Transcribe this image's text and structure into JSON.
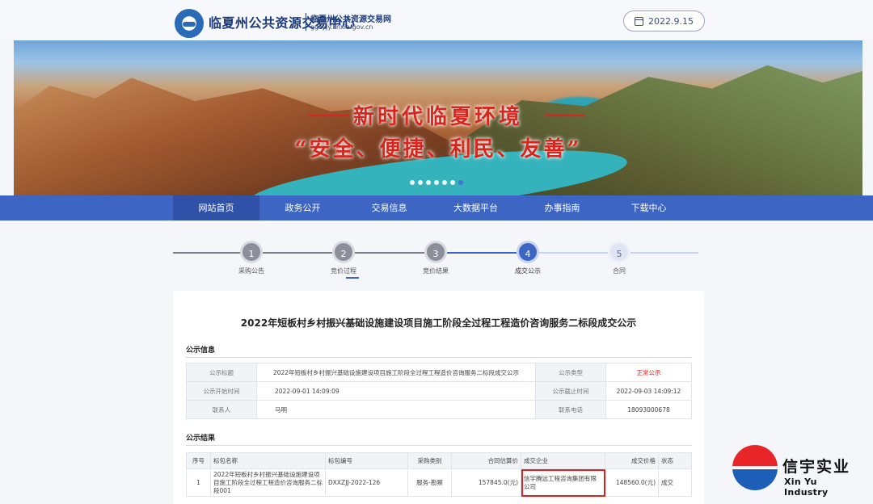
{
  "header": {
    "site_name": "临夏州公共资源交易中心",
    "site_subname": "临夏州公共资源交易网",
    "site_url": "ggzyjy.linxia.gov.cn",
    "date": "2022.9.15"
  },
  "banner": {
    "slogan_main": "新时代临夏环境",
    "slogan_sub": "“安全、便捷、利民、友善”",
    "slide_count": 7,
    "active_slide": 6
  },
  "nav": {
    "items": [
      "网站首页",
      "政务公开",
      "交易信息",
      "大数据平台",
      "办事指南",
      "下载中心"
    ],
    "active_index": 0
  },
  "steps": [
    {
      "num": "1",
      "label": "采购公告",
      "state": "done"
    },
    {
      "num": "2",
      "label": "竞价过程",
      "state": "done"
    },
    {
      "num": "3",
      "label": "竞价结果",
      "state": "done"
    },
    {
      "num": "4",
      "label": "成交公示",
      "state": "active"
    },
    {
      "num": "5",
      "label": "合同",
      "state": "pending"
    }
  ],
  "document": {
    "title": "2022年短板村乡村振兴基础设施建设项目施工阶段全过程工程造价咨询服务二标段成交公示",
    "info_section": "公示信息",
    "info": {
      "title_key": "公示标题",
      "title_val": "2022年短板村乡村振兴基础设施建设项目施工阶段全过程工程造价咨询服务二标段成交公示",
      "type_key": "公示类型",
      "type_val": "正常公示",
      "start_key": "公示开始时间",
      "start_val": "2022-09-01 14:09:09",
      "end_key": "公示截止时间",
      "end_val": "2022-09-03 14:09:12",
      "contact_key": "联系人",
      "contact_val": "马明",
      "phone_key": "联系电话",
      "phone_val": "18093000678"
    },
    "result_section": "公示结果",
    "result_headers": [
      "序号",
      "标包名称",
      "标包编号",
      "采购类别",
      "合同估算价",
      "成交企业",
      "成交价格",
      "状态"
    ],
    "result_rows": [
      [
        "1",
        "2022年短板村乡村振兴基础设施建设项目施工阶段全过程工程造价咨询服务二标段001",
        "DXXZJJ-2022-126",
        "服务-勘察",
        "157845.0(元)",
        "信宇腾远工程咨询集团有限公司",
        "148560.0(元)",
        "成交"
      ]
    ]
  },
  "watermark": {
    "cn": "信宇实业",
    "en": "Xin Yu Industry"
  }
}
